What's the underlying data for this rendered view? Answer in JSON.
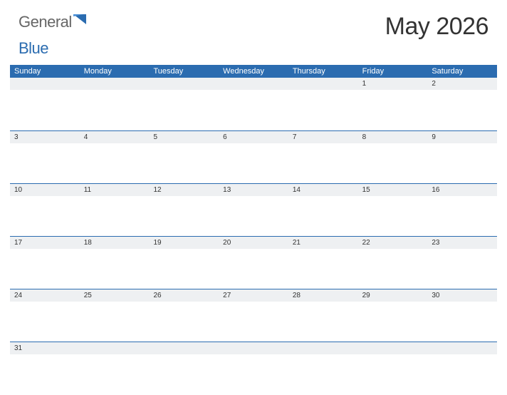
{
  "logo": {
    "text1": "General",
    "text2": "Blue"
  },
  "title": "May 2026",
  "days_of_week": [
    "Sunday",
    "Monday",
    "Tuesday",
    "Wednesday",
    "Thursday",
    "Friday",
    "Saturday"
  ],
  "weeks": [
    [
      "",
      "",
      "",
      "",
      "",
      "1",
      "2"
    ],
    [
      "3",
      "4",
      "5",
      "6",
      "7",
      "8",
      "9"
    ],
    [
      "10",
      "11",
      "12",
      "13",
      "14",
      "15",
      "16"
    ],
    [
      "17",
      "18",
      "19",
      "20",
      "21",
      "22",
      "23"
    ],
    [
      "24",
      "25",
      "26",
      "27",
      "28",
      "29",
      "30"
    ],
    [
      "31",
      "",
      "",
      "",
      "",
      "",
      ""
    ]
  ]
}
